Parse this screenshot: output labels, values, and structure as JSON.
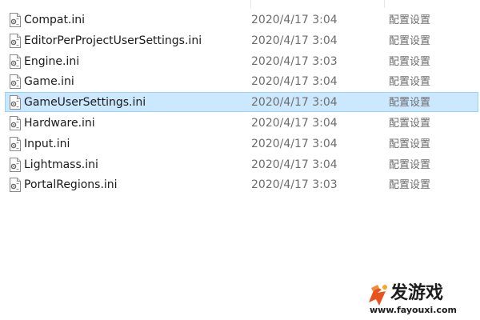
{
  "files": [
    {
      "name": "Compat.ini",
      "date": "2020/4/17 3:04",
      "type": "配置设置",
      "icon": "config-file-icon",
      "selected": false
    },
    {
      "name": "EditorPerProjectUserSettings.ini",
      "date": "2020/4/17 3:04",
      "type": "配置设置",
      "icon": "config-file-icon",
      "selected": false
    },
    {
      "name": "Engine.ini",
      "date": "2020/4/17 3:03",
      "type": "配置设置",
      "icon": "config-file-icon",
      "selected": false
    },
    {
      "name": "Game.ini",
      "date": "2020/4/17 3:04",
      "type": "配置设置",
      "icon": "config-file-icon",
      "selected": false
    },
    {
      "name": "GameUserSettings.ini",
      "date": "2020/4/17 3:04",
      "type": "配置设置",
      "icon": "config-file-icon",
      "selected": true
    },
    {
      "name": "Hardware.ini",
      "date": "2020/4/17 3:04",
      "type": "配置设置",
      "icon": "config-file-icon",
      "selected": false
    },
    {
      "name": "Input.ini",
      "date": "2020/4/17 3:04",
      "type": "配置设置",
      "icon": "config-file-icon",
      "selected": false
    },
    {
      "name": "Lightmass.ini",
      "date": "2020/4/17 3:04",
      "type": "配置设置",
      "icon": "config-file-icon",
      "selected": false
    },
    {
      "name": "PortalRegions.ini",
      "date": "2020/4/17 3:03",
      "type": "配置设置",
      "icon": "config-file-icon",
      "selected": false
    }
  ],
  "watermark": {
    "title": "发游戏",
    "url": "www.fayouxi.com"
  },
  "colors": {
    "selection_background": "#cce8ff",
    "selection_border": "#99d1ff",
    "secondary_text": "#6d6d6d",
    "watermark_accent": "#e8541c"
  }
}
